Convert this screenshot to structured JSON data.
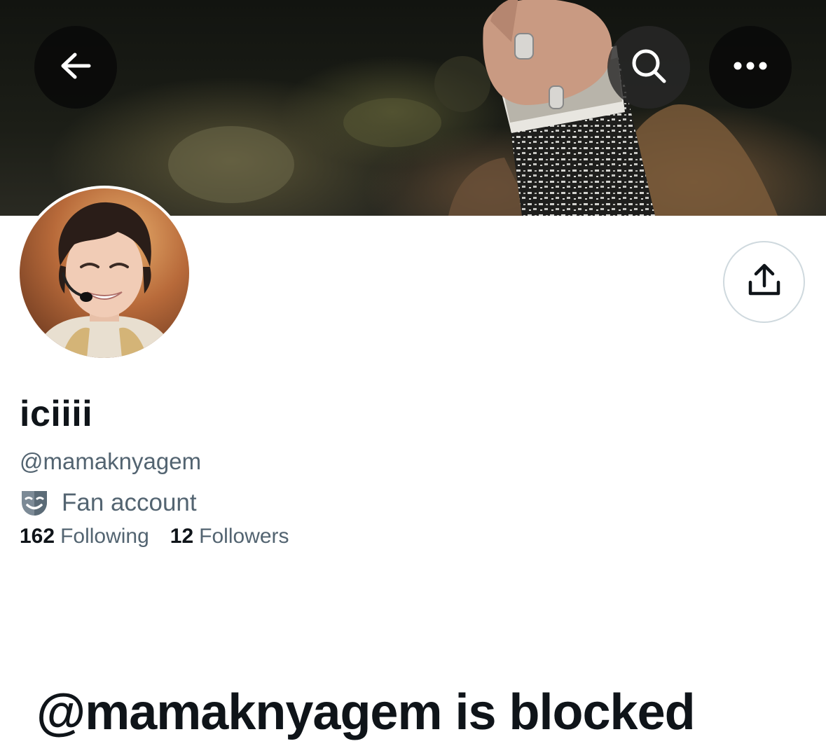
{
  "header": {
    "back_icon": "arrow-left-icon",
    "search_icon": "search-icon",
    "more_icon": "more-horizontal-icon"
  },
  "profile": {
    "display_name": "iciiii",
    "handle": "@mamaknyagem",
    "category_icon": "theater-masks-icon",
    "category": "Fan account",
    "following_count": "162",
    "following_label": "Following",
    "followers_count": "12",
    "followers_label": "Followers"
  },
  "actions": {
    "share_icon": "share-icon"
  },
  "blocked": {
    "title": "@mamaknyagem is blocked"
  },
  "colors": {
    "primary_text": "#0f1419",
    "secondary_text": "#536471",
    "border": "#cfd9de",
    "nav_button_bg": "#080808"
  }
}
